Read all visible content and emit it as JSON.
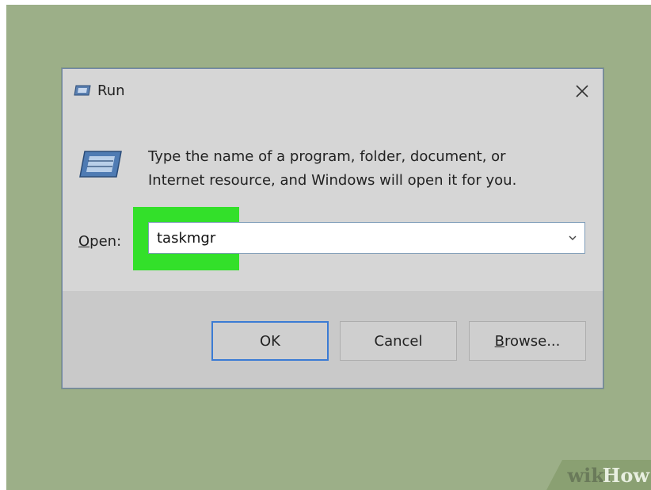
{
  "window": {
    "title": "Run",
    "title_icon": "run-icon",
    "close_icon": "close-icon"
  },
  "content": {
    "description_line1": "Type the name of a program, folder, document, or",
    "description_line2": "Internet resource, and Windows will open it for you.",
    "run_icon": "run-icon"
  },
  "open_field": {
    "label_accel": "O",
    "label_rest": "pen:",
    "value": "taskmgr",
    "dropdown_icon": "chevron-down-icon"
  },
  "buttons": {
    "ok": "OK",
    "cancel": "Cancel",
    "browse_accel": "B",
    "browse_rest": "rowse..."
  },
  "watermark": {
    "part1": "wiki",
    "part2": "How"
  },
  "colors": {
    "background": "#9caf88",
    "dialog": "#d6d6d6",
    "footer": "#c9c9c9",
    "highlight": "#33e02a",
    "ok_border": "#3b7bd4"
  }
}
